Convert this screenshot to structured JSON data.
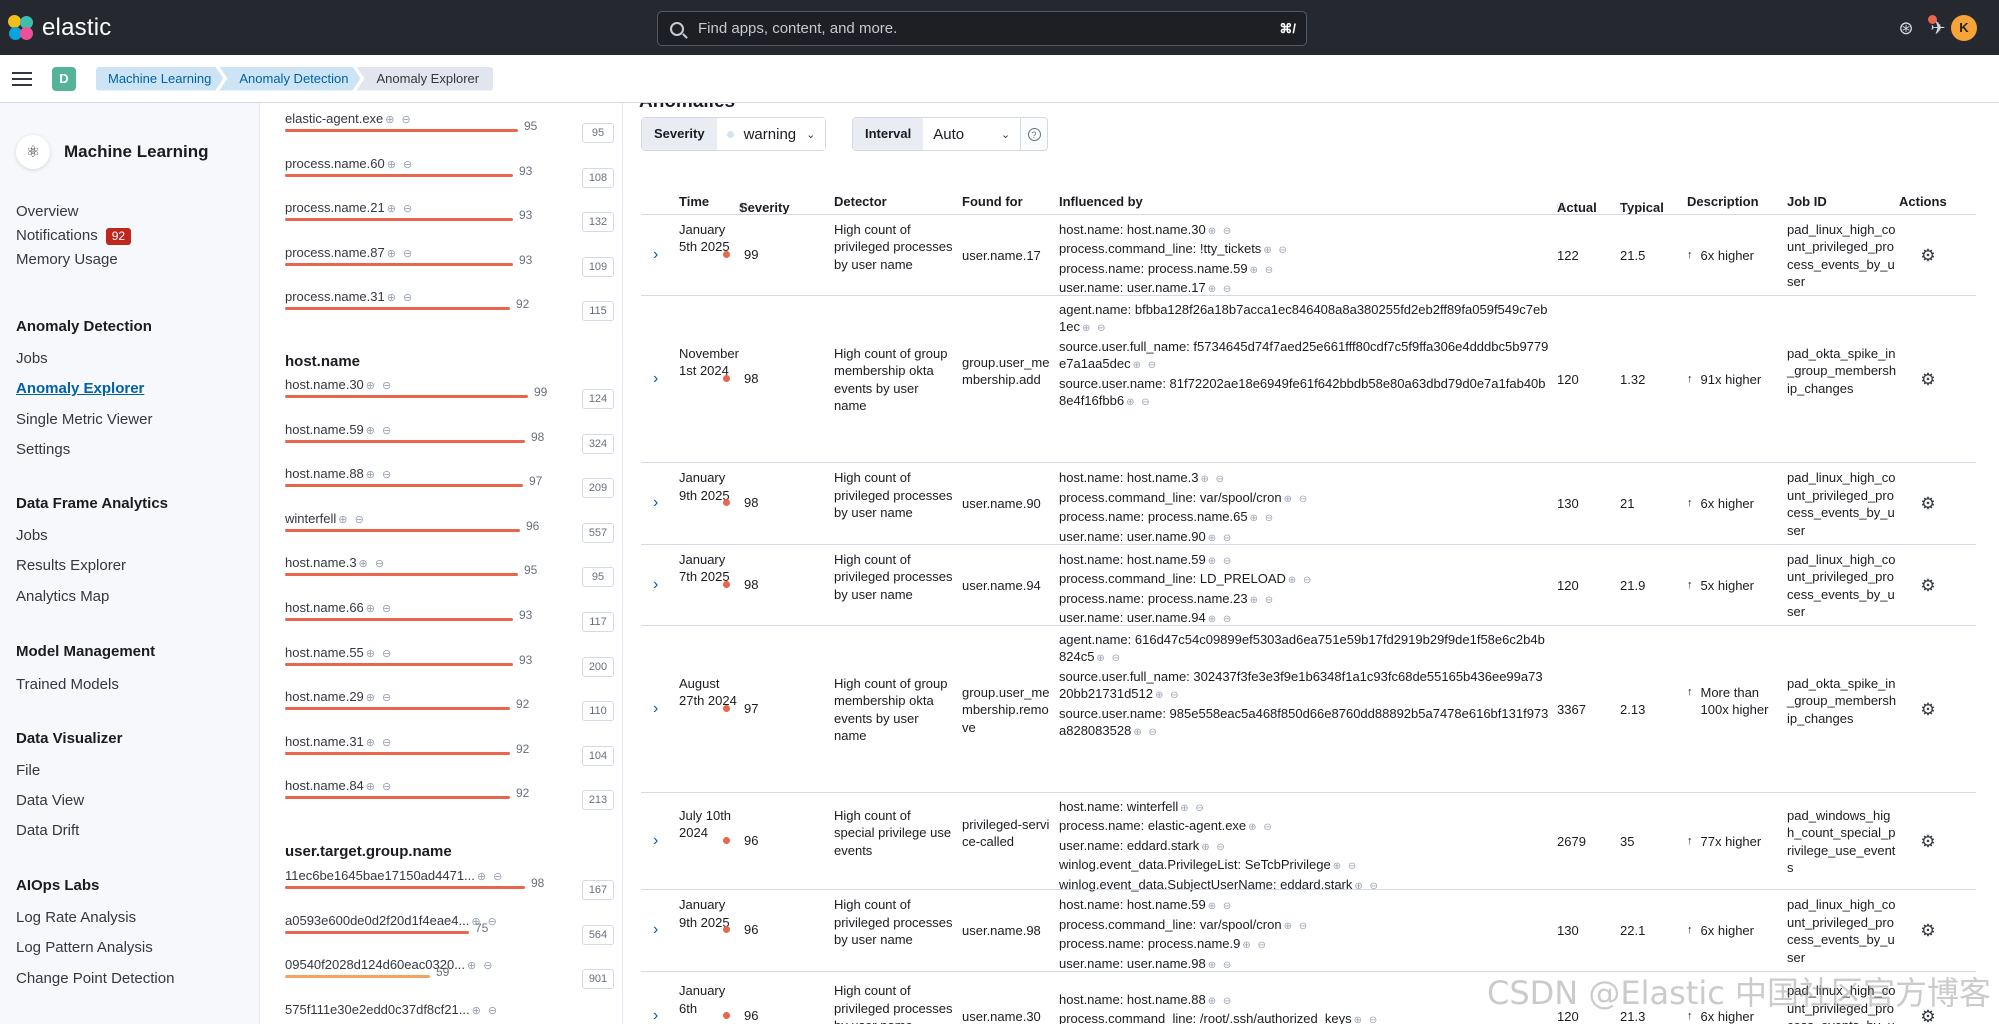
{
  "topbar": {
    "logo_text": "elastic",
    "search_placeholder": "Find apps, content, and more.",
    "search_shortcut": "⌘/",
    "avatar_initial": "K"
  },
  "breadcrumbs": {
    "space_initial": "D",
    "items": [
      "Machine Learning",
      "Anomaly Detection",
      "Anomaly Explorer"
    ]
  },
  "sidebar": {
    "title": "Machine Learning",
    "overview": "Overview",
    "notifications": "Notifications",
    "notifications_count": "92",
    "memory_usage": "Memory Usage",
    "anomaly_detection": "Anomaly Detection",
    "ad_jobs": "Jobs",
    "anomaly_explorer": "Anomaly Explorer",
    "single_metric_viewer": "Single Metric Viewer",
    "ad_settings": "Settings",
    "data_frame_analytics": "Data Frame Analytics",
    "dfa_jobs": "Jobs",
    "results_explorer": "Results Explorer",
    "analytics_map": "Analytics Map",
    "model_management": "Model Management",
    "trained_models": "Trained Models",
    "data_visualizer": "Data Visualizer",
    "file": "File",
    "data_view": "Data View",
    "data_drift": "Data Drift",
    "aiops_labs": "AIOps Labs",
    "log_rate_analysis": "Log Rate Analysis",
    "log_pattern_analysis": "Log Pattern Analysis",
    "change_point_detection": "Change Point Detection"
  },
  "influencers": {
    "process_items": [
      {
        "name": "elastic-agent.exe",
        "score": "95",
        "total": "95",
        "fill": 0.95
      },
      {
        "name": "process.name.60",
        "score": "93",
        "total": "108",
        "fill": 0.93
      },
      {
        "name": "process.name.21",
        "score": "93",
        "total": "132",
        "fill": 0.93
      },
      {
        "name": "process.name.87",
        "score": "93",
        "total": "109",
        "fill": 0.93
      },
      {
        "name": "process.name.31",
        "score": "92",
        "total": "115",
        "fill": 0.92
      }
    ],
    "host_header": "host.name",
    "host_items": [
      {
        "name": "host.name.30",
        "score": "99",
        "total": "124",
        "fill": 0.99
      },
      {
        "name": "host.name.59",
        "score": "98",
        "total": "324",
        "fill": 0.98
      },
      {
        "name": "host.name.88",
        "score": "97",
        "total": "209",
        "fill": 0.97
      },
      {
        "name": "winterfell",
        "score": "96",
        "total": "557",
        "fill": 0.96
      },
      {
        "name": "host.name.3",
        "score": "95",
        "total": "95",
        "fill": 0.95
      },
      {
        "name": "host.name.66",
        "score": "93",
        "total": "117",
        "fill": 0.93
      },
      {
        "name": "host.name.55",
        "score": "93",
        "total": "200",
        "fill": 0.93
      },
      {
        "name": "host.name.29",
        "score": "92",
        "total": "110",
        "fill": 0.92
      },
      {
        "name": "host.name.31",
        "score": "92",
        "total": "104",
        "fill": 0.92
      },
      {
        "name": "host.name.84",
        "score": "92",
        "total": "213",
        "fill": 0.92
      }
    ],
    "group_header": "user.target.group.name",
    "group_items": [
      {
        "name": "11ec6be1645bae17150ad4471...",
        "score": "98",
        "total": "167",
        "fill": 0.98
      },
      {
        "name": "a0593e600de0d2f20d1f4eae4...",
        "score": "75",
        "total": "564",
        "fill": 0.75
      },
      {
        "name": "09540f2028d124d60eac0320...",
        "score": "59",
        "total": "901",
        "fill": 0.59
      },
      {
        "name": "575f111e30e2edd0c37df8cf21...",
        "score": "",
        "total": "",
        "fill": 0
      }
    ]
  },
  "anomalies": {
    "title": "Anomalies",
    "severity_label": "Severity",
    "severity_value": "warning",
    "interval_label": "Interval",
    "interval_value": "Auto",
    "columns": {
      "time": "Time",
      "severity": "Severity",
      "detector": "Detector",
      "found_for": "Found for",
      "influenced_by": "Influenced by",
      "actual": "Actual",
      "typical": "Typical",
      "description": "Description",
      "job_id": "Job ID",
      "actions": "Actions"
    },
    "rows": [
      {
        "time": "January 5th 2025",
        "severity": "99",
        "detector": "High count of privileged processes by user name",
        "found_for": "user.name.17",
        "influencers": [
          "host.name: host.name.30",
          "process.command_line: !tty_tickets",
          "process.name: process.name.59",
          "user.name: user.name.17"
        ],
        "actual": "122",
        "typical": "21.5",
        "description": "6x higher",
        "job_id": "pad_linux_high_count_privileged_process_events_by_user"
      },
      {
        "time": "November 1st 2024",
        "severity": "98",
        "detector": "High count of group membership okta events by user name",
        "found_for": "group.user_membership.add",
        "influencers": [
          "agent.name: bfbba128f26a18b7acca1ec846408a8a380255fd2eb2ff89fa059f549c7eb1ec",
          "source.user.full_name: f5734645d74f7aed25e661fff80cdf7c5f9ffa306e4dddbc5b9779e7a1aa5dec",
          "source.user.name: 81f72202ae18e6949fe61f642bbdb58e80a63dbd79d0e7a1fab40b8e4f16fbb6"
        ],
        "actual": "120",
        "typical": "1.32",
        "description": "91x higher",
        "job_id": "pad_okta_spike_in_group_membership_changes"
      },
      {
        "time": "January 9th 2025",
        "severity": "98",
        "detector": "High count of privileged processes by user name",
        "found_for": "user.name.90",
        "influencers": [
          "host.name: host.name.3",
          "process.command_line: var/spool/cron",
          "process.name: process.name.65",
          "user.name: user.name.90"
        ],
        "actual": "130",
        "typical": "21",
        "description": "6x higher",
        "job_id": "pad_linux_high_count_privileged_process_events_by_user"
      },
      {
        "time": "January 7th 2025",
        "severity": "98",
        "detector": "High count of privileged processes by user name",
        "found_for": "user.name.94",
        "influencers": [
          "host.name: host.name.59",
          "process.command_line: LD_PRELOAD",
          "process.name: process.name.23",
          "user.name: user.name.94"
        ],
        "actual": "120",
        "typical": "21.9",
        "description": "5x higher",
        "job_id": "pad_linux_high_count_privileged_process_events_by_user"
      },
      {
        "time": "August 27th 2024",
        "severity": "97",
        "detector": "High count of group membership okta events by user name",
        "found_for": "group.user_membership.remove",
        "influencers": [
          "agent.name: 616d47c54c09899ef5303ad6ea751e59b17fd2919b29f9de1f58e6c2b4b824c5",
          "source.user.full_name: 302437f3fe3e3f9e1b6348f1a1c93fc68de55165b436ee99a7320bb21731d512",
          "source.user.name: 985e558eac5a468f850d66e8760dd88892b5a7478e616bf131f973a828083528"
        ],
        "actual": "3367",
        "typical": "2.13",
        "description": "More than 100x higher",
        "job_id": "pad_okta_spike_in_group_membership_changes"
      },
      {
        "time": "July 10th 2024",
        "severity": "96",
        "detector": "High count of special privilege use events",
        "found_for": "privileged-service-called",
        "influencers": [
          "host.name: winterfell",
          "process.name: elastic-agent.exe",
          "user.name: eddard.stark",
          "winlog.event_data.PrivilegeList: SeTcbPrivilege",
          "winlog.event_data.SubjectUserName: eddard.stark"
        ],
        "actual": "2679",
        "typical": "35",
        "description": "77x higher",
        "job_id": "pad_windows_high_count_special_privilege_use_events"
      },
      {
        "time": "January 9th 2025",
        "severity": "96",
        "detector": "High count of privileged processes by user name",
        "found_for": "user.name.98",
        "influencers": [
          "host.name: host.name.59",
          "process.command_line: var/spool/cron",
          "process.name: process.name.9",
          "user.name: user.name.98"
        ],
        "actual": "130",
        "typical": "22.1",
        "description": "6x higher",
        "job_id": "pad_linux_high_count_privileged_process_events_by_user"
      },
      {
        "time": "January 6th",
        "severity": "96",
        "detector": "High count of privileged processes by user name",
        "found_for": "user.name.30",
        "influencers": [
          "host.name: host.name.88",
          "process.command_line: /root/.ssh/authorized_keys",
          "process.name: process.name.64"
        ],
        "actual": "120",
        "typical": "21.3",
        "description": "6x higher",
        "job_id": "pad_linux_high_count_privileged_process_events_by_user"
      }
    ]
  },
  "watermark": "CSDN @Elastic 中国社区官方博客"
}
